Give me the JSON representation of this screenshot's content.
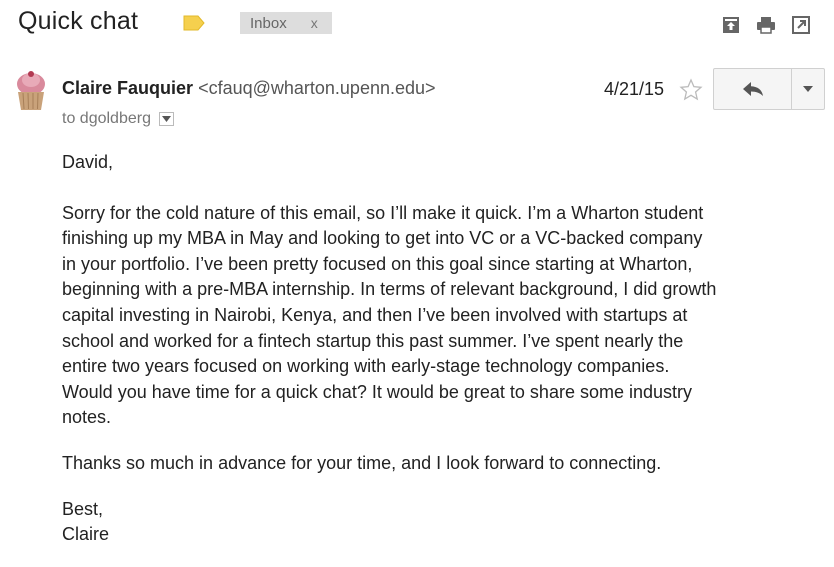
{
  "header": {
    "subject": "Quick chat",
    "label_color": "#f5d04e",
    "inbox_chip": {
      "label": "Inbox",
      "close": "x"
    },
    "icons": [
      "archive-icon",
      "print-icon",
      "new-window-icon"
    ]
  },
  "message": {
    "sender_name": "Claire Fauquier",
    "sender_email": "<cfauq@wharton.upenn.edu>",
    "to_line": "to dgoldberg",
    "date": "4/21/15",
    "avatar_icon": "cupcake-avatar",
    "body": {
      "greeting": "David,",
      "paragraph1_lines": [
        "Sorry for the cold nature of this email, so I’ll make it quick. I’m a Wharton student",
        "finishing up my MBA in May and looking to get into VC or a VC-backed company",
        "in your portfolio. I’ve been pretty focused on this goal since starting at Wharton,",
        "beginning with a pre-MBA internship. In terms of relevant background, I did growth",
        "capital investing in Nairobi, Kenya, and then I’ve been involved with startups at",
        "school and worked for a fintech startup this past summer. I’ve spent nearly the",
        "entire two years focused on working with early-stage technology companies.",
        "Would you have time for a quick chat? It would be great to share some industry",
        "notes."
      ],
      "paragraph2": "Thanks so much in advance for your time, and I look forward to connecting.",
      "signoff": "Best,",
      "signature": "Claire"
    }
  }
}
